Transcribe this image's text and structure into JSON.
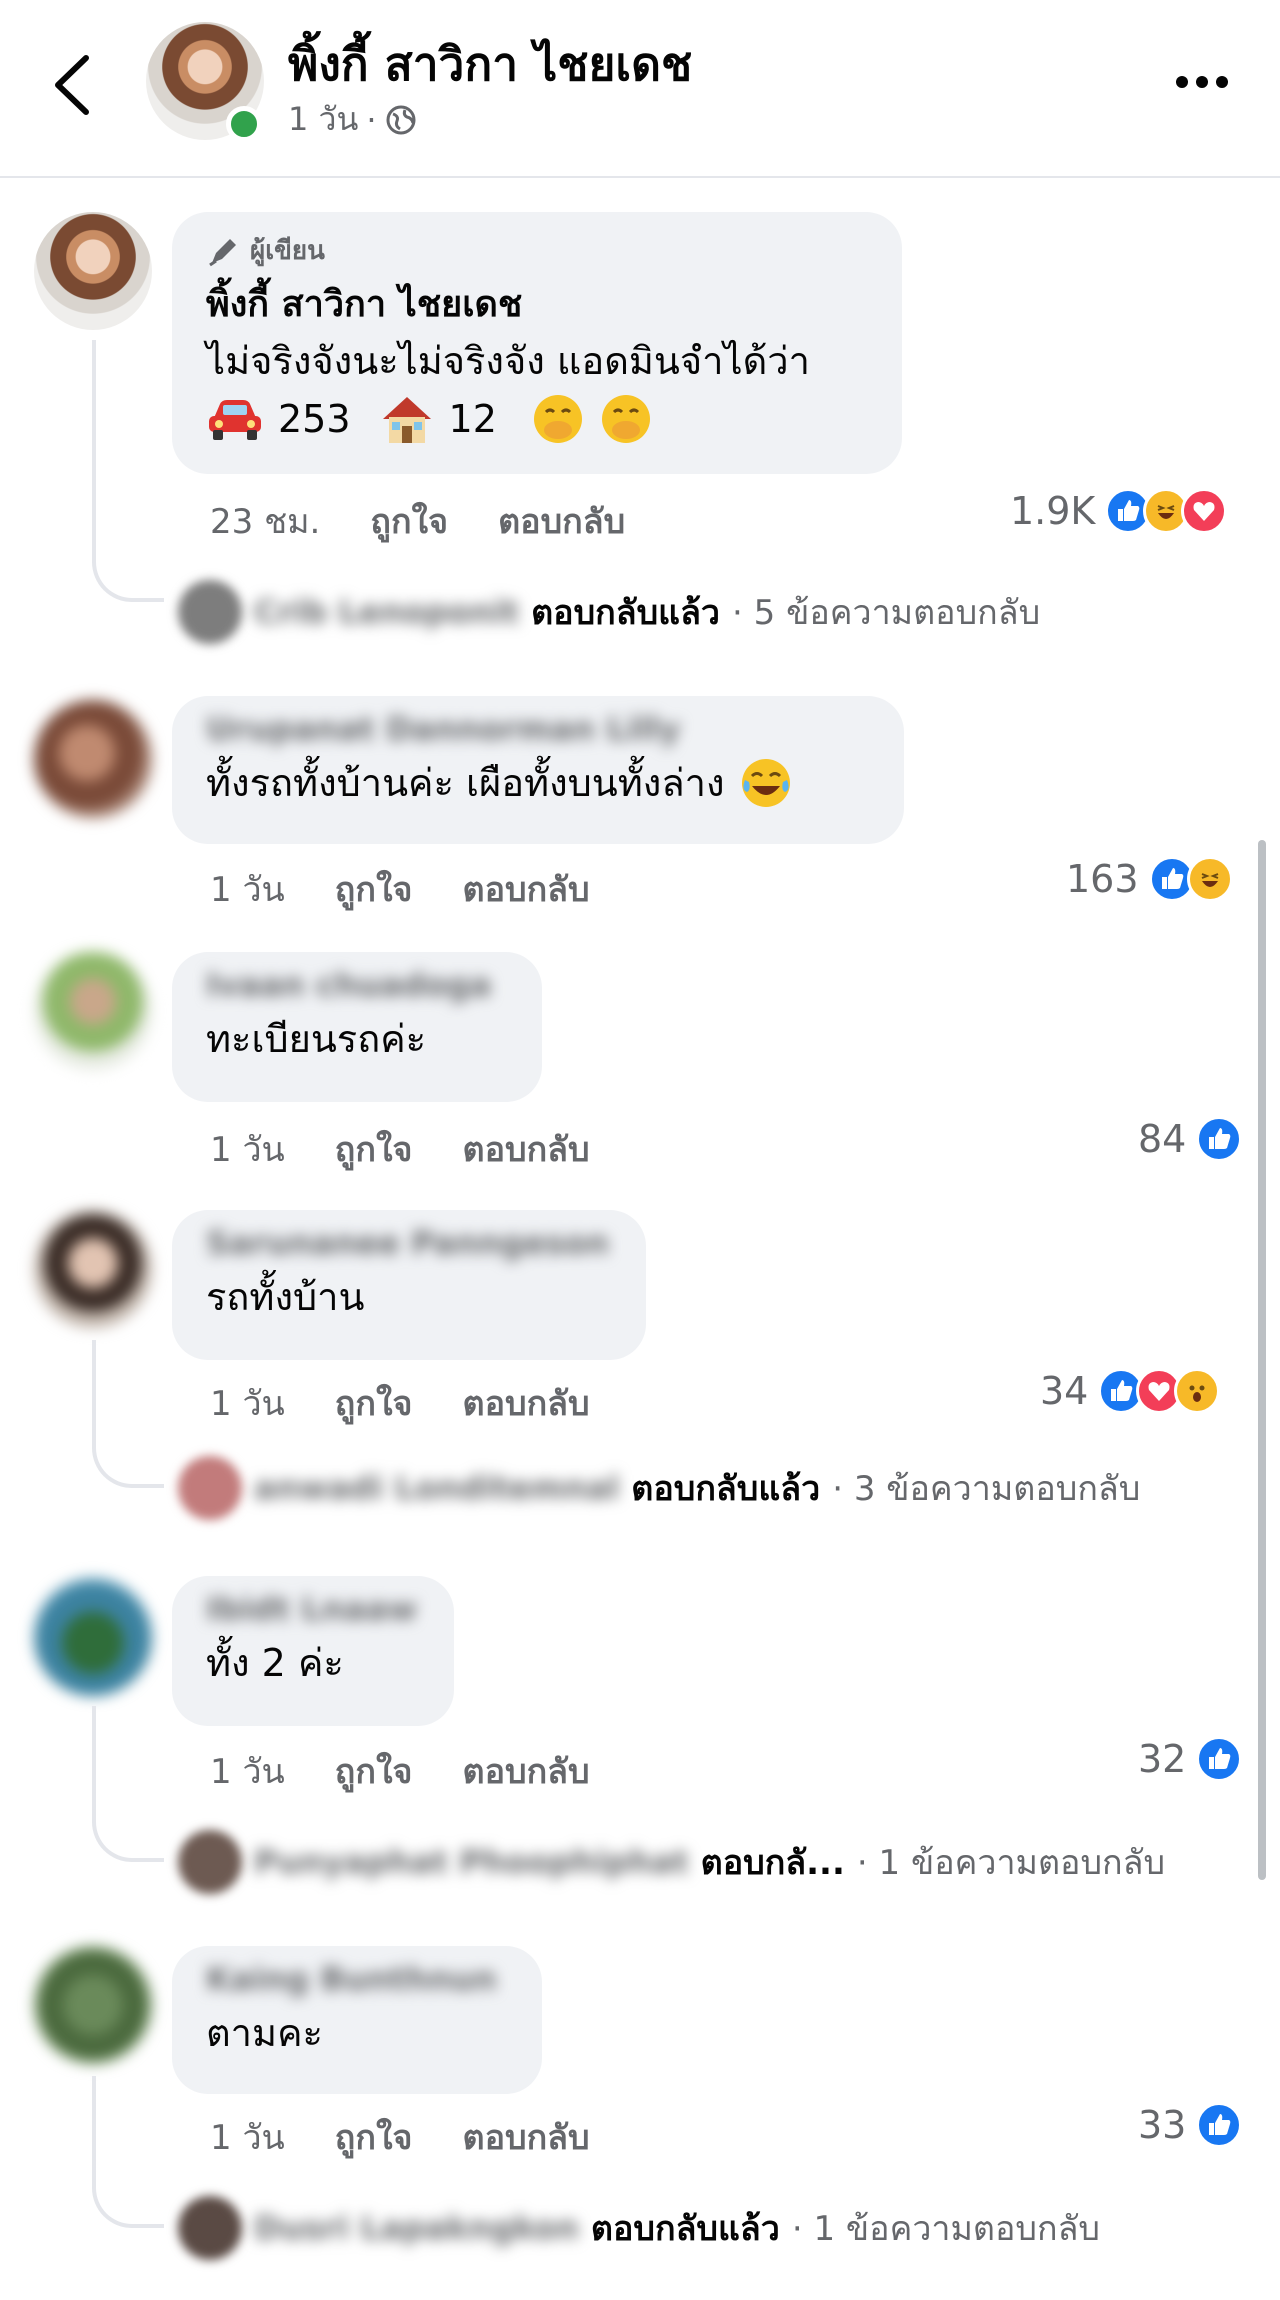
{
  "header": {
    "name": "พิ้งกี้ สาวิกา ไชยเดช",
    "time": "1 วัน",
    "separator": "·"
  },
  "colors": {
    "like": "#1877f2",
    "love": "#f33e58",
    "haha": "#f7b928",
    "online": "#31a24c",
    "bubble": "#f0f2f5",
    "secondary_text": "#65676b"
  },
  "comments": [
    {
      "author_badge": "ผู้เขียน",
      "name": "พิ้งกี้ สาวิกา ไชยเดช",
      "line1": "ไม่จริงจังนะไม่จริงจัง แอดมินจำได้ว่า",
      "car_count": "253",
      "house_count": "12",
      "time": "23 ชม.",
      "like_label": "ถูกใจ",
      "reply_label": "ตอบกลับ",
      "reaction_count": "1.9K",
      "reactions": [
        "like-icon",
        "haha-icon",
        "love-icon"
      ],
      "reply_author": "Crib Lenoponit",
      "reply_link": "ตอบกลับแล้ว",
      "reply_count": "· 5 ข้อความตอบกลับ"
    },
    {
      "name": "Urupanat Dannorman Lilly",
      "text": "ทั้งรถทั้งบ้านค่ะ เผือทั้งบนทั้งล่าง",
      "time": "1 วัน",
      "like_label": "ถูกใจ",
      "reply_label": "ตอบกลับ",
      "reaction_count": "163",
      "reactions": [
        "like-icon",
        "haha-icon"
      ]
    },
    {
      "name": "Ivaan chuadoga",
      "text": "ทะเบียนรถค่ะ",
      "time": "1 วัน",
      "like_label": "ถูกใจ",
      "reply_label": "ตอบกลับ",
      "reaction_count": "84",
      "reactions": [
        "like-icon"
      ]
    },
    {
      "name": "Sarunanee Panngeson",
      "text": "รถทั้งบ้าน",
      "time": "1 วัน",
      "like_label": "ถูกใจ",
      "reply_label": "ตอบกลับ",
      "reaction_count": "34",
      "reactions": [
        "like-icon",
        "love-icon",
        "wow-icon"
      ],
      "reply_author": "anwadi Londitemnal",
      "reply_link": "ตอบกลับแล้ว",
      "reply_count": "· 3 ข้อความตอบกลับ"
    },
    {
      "name": "Ibidt Lnaaw",
      "text": "ทั้ง 2 ค่ะ",
      "time": "1 วัน",
      "like_label": "ถูกใจ",
      "reply_label": "ตอบกลับ",
      "reaction_count": "32",
      "reactions": [
        "like-icon"
      ],
      "reply_author": "Punyaphat Phoophiphat",
      "reply_link": "ตอบกลั...",
      "reply_count": "· 1 ข้อความตอบกลับ"
    },
    {
      "name": "Kaing Bunthnun",
      "text": "ตามคะ",
      "time": "1 วัน",
      "like_label": "ถูกใจ",
      "reply_label": "ตอบกลับ",
      "reaction_count": "33",
      "reactions": [
        "like-icon"
      ],
      "reply_author": "Dusri Lapakngkon",
      "reply_link": "ตอบกลับแล้ว",
      "reply_count": "· 1 ข้อความตอบกลับ"
    }
  ]
}
